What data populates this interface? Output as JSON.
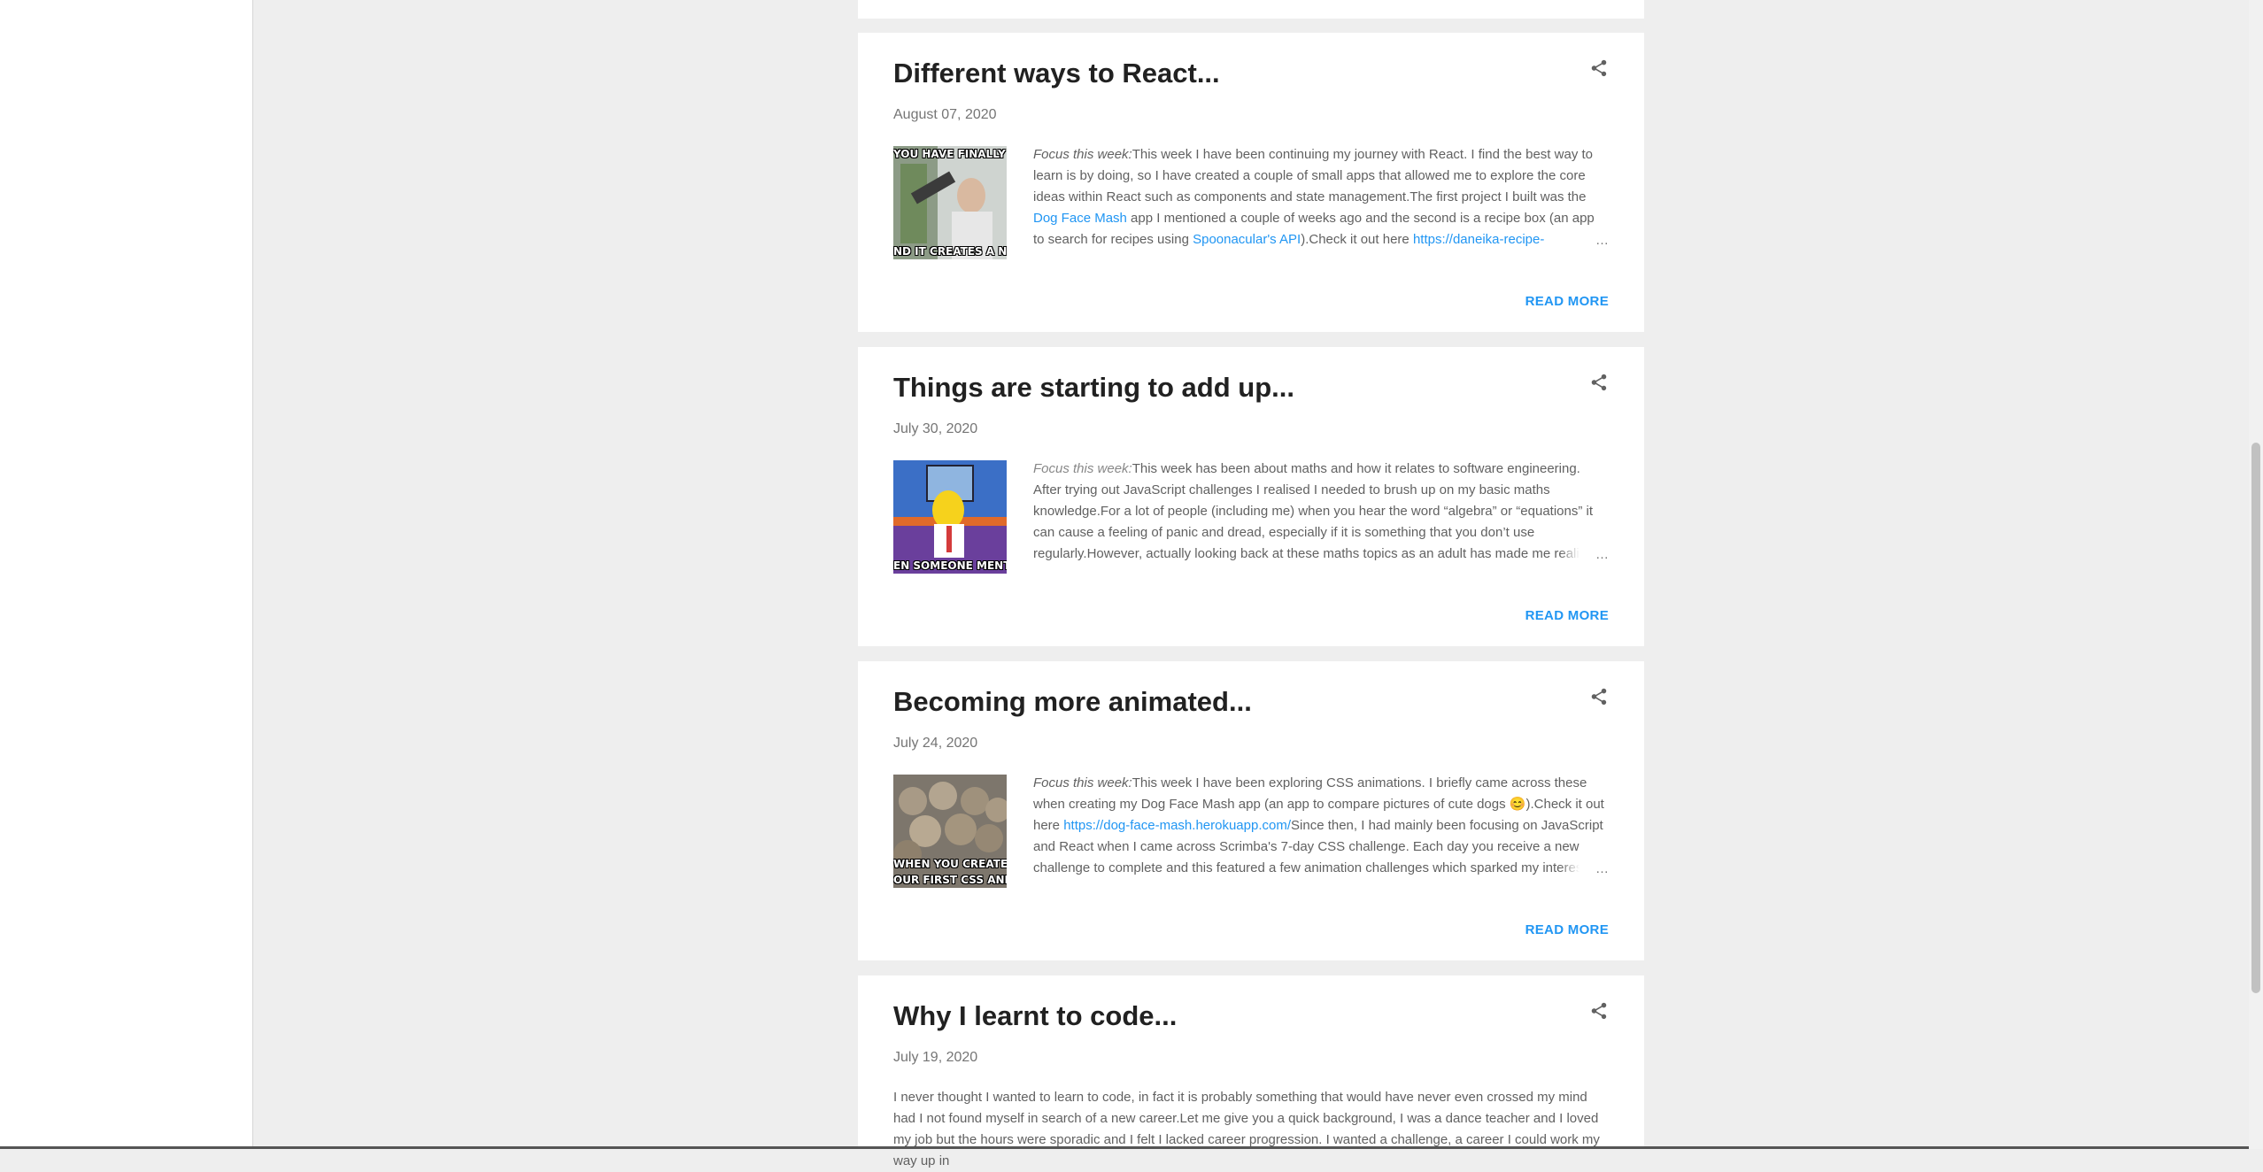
{
  "posts": [
    {
      "title": "Different ways to React...",
      "date": "August 07, 2020",
      "thumb_top": "YOU HAVE FINALLY FIXED A",
      "thumb_bottom": "ND IT CREATES A NEW ONE",
      "focus_label": "Focus this week:",
      "s1": "This week I have been continuing my journey with React. I find the best way to learn is by doing, so I have created a couple of small apps that allowed me to explore the core ideas within React such as components and state management.The first project I built was the ",
      "l1": "Dog Face Mash",
      "s2": " app I mentioned a couple of weeks ago and the second is a recipe box (an app to search for recipes using ",
      "l2": "Spoonacular's API",
      "s3": ").Check it out here ",
      "l3": "https://daneika-recipe-",
      "ellipsis": "…",
      "read_more": "READ MORE"
    },
    {
      "title": "Things are starting to add up...",
      "date": "July 30, 2020",
      "thumb_bottom": "EN SOMEONE MENTIONS ALGE",
      "focus_label": "Focus this week:",
      "s1": "This week has been about maths and how it relates to software engineering. After trying out JavaScript challenges I realised I needed to brush up on my basic maths knowledge.For a lot of people (including me) when you hear the word “algebra” or “equations” it can cause a feeling of panic and dread, especially if it is something that you don’t use regularly.However, actually looking back at these maths topics as an adult has made me realise they are perhaps not",
      "ellipsis": "…",
      "read_more": "READ MORE"
    },
    {
      "title": "Becoming more animated...",
      "date": "July 24, 2020",
      "thumb_mid": "WHEN YOU CREATE",
      "thumb_bottom": "OUR FIRST CSS ANIMATIO",
      "focus_label": "Focus this week:",
      "s1": "This week I have been exploring CSS animations. I briefly came across these when creating my Dog Face Mash app (an app to compare pictures of cute dogs ",
      "emoji": "😊",
      "s2": ").Check it out here ",
      "l1": "https://dog-face-mash.herokuapp.com/",
      "s3": "Since then, I had mainly been focusing on JavaScript and React when I came across Scrimba's 7-day CSS challenge. Each day you receive a new challenge to complete and this featured a few animation challenges which sparked my interest",
      "ellipsis": "…",
      "read_more": "READ MORE"
    },
    {
      "title": "Why I learnt to code...",
      "date": "July 19, 2020",
      "s1": "I never thought I wanted to learn to code, in fact it is probably something that would have never even crossed my mind had I not found myself in search of a new career.Let me give you a quick background, I was a dance teacher and I loved my job but the hours were sporadic and I felt I lacked career progression. I wanted a challenge, a career I could work my way up in"
    }
  ]
}
